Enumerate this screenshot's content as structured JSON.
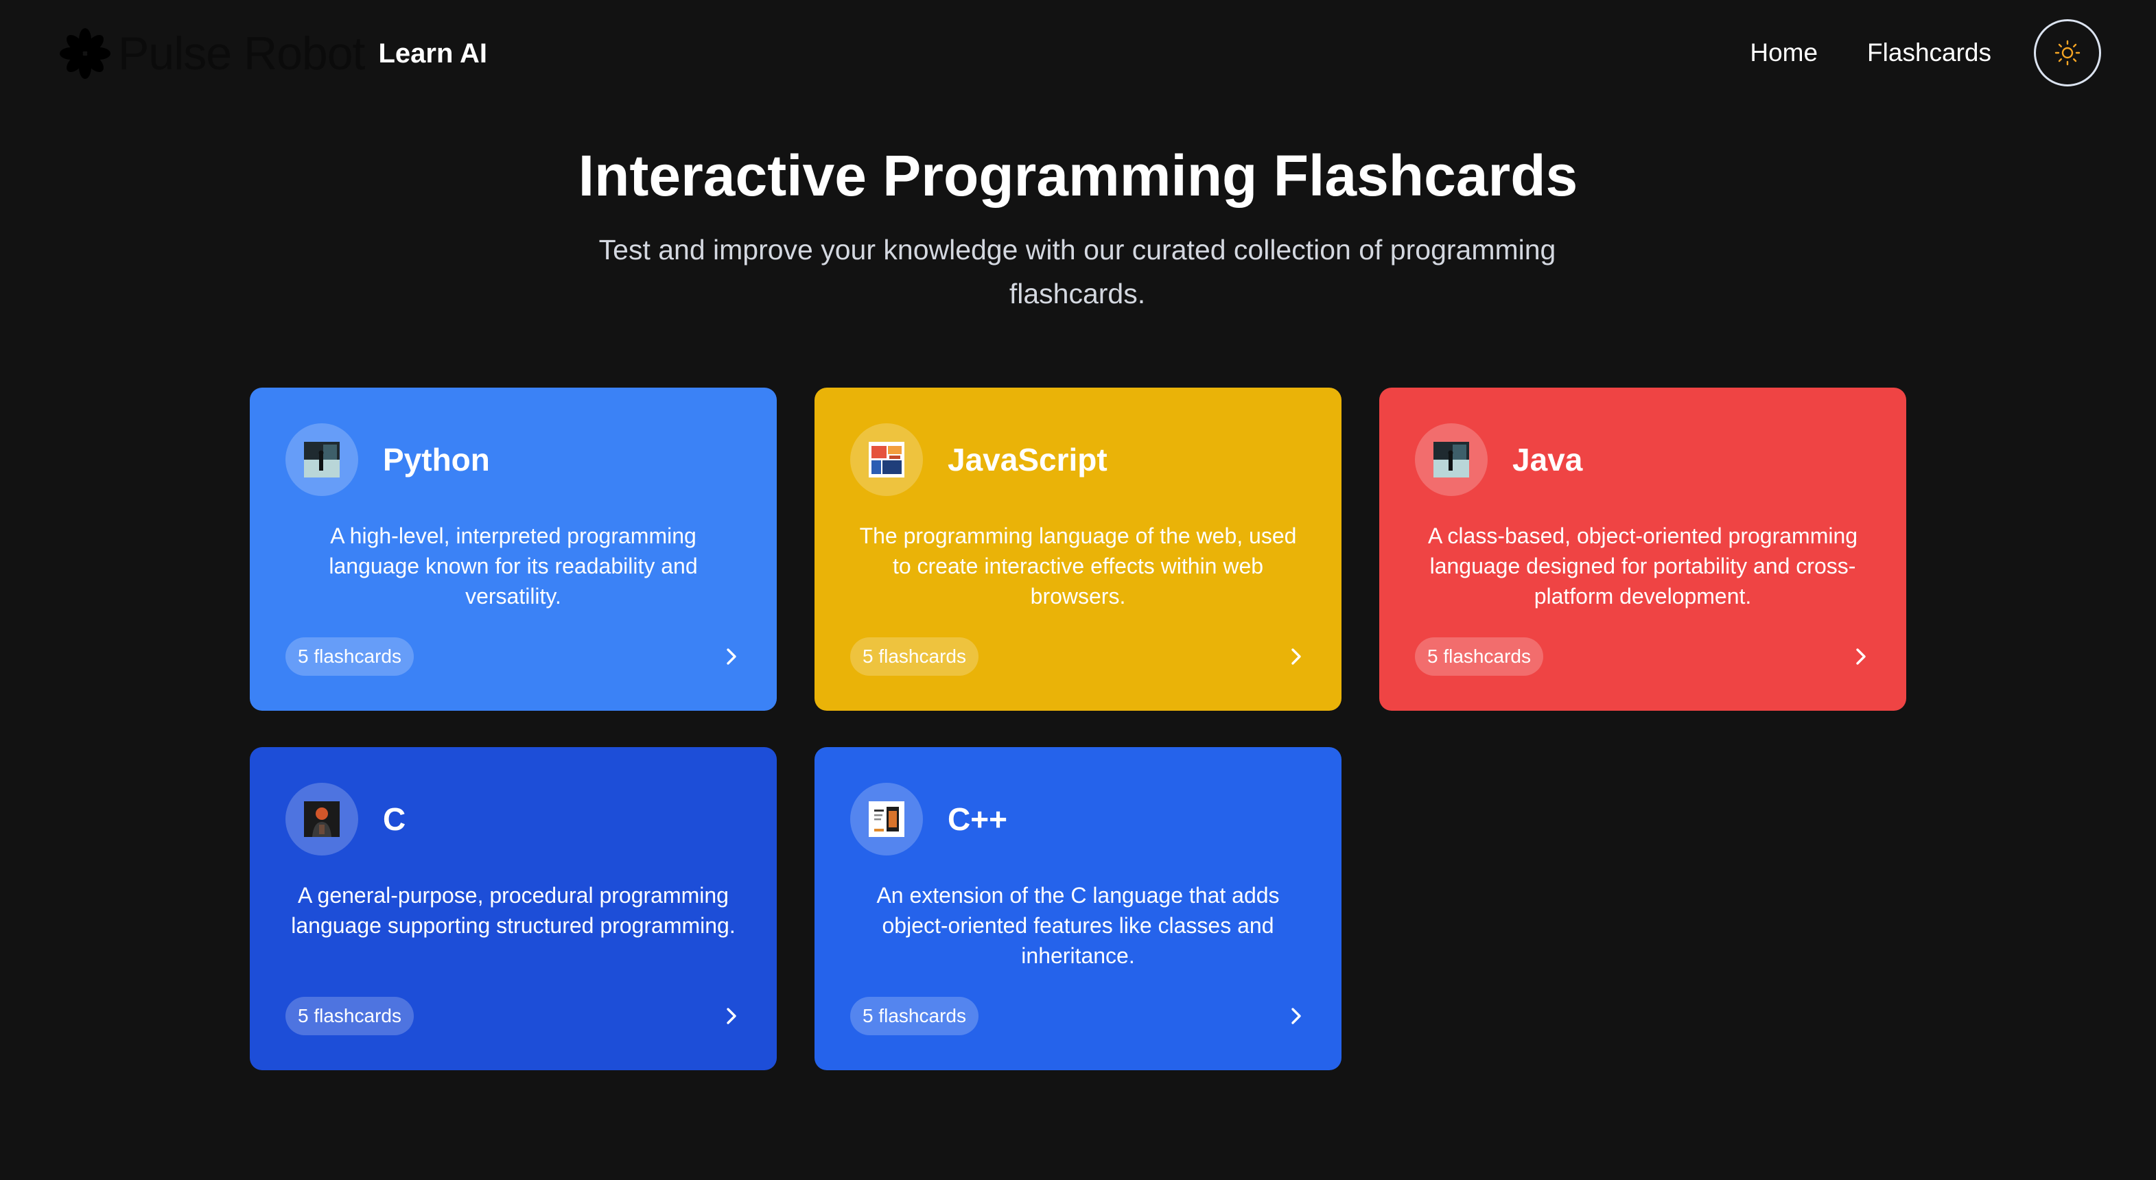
{
  "header": {
    "logo_text": "Pulse Robot",
    "logo_icon": "asterisk-logo-icon",
    "subtitle": "Learn AI",
    "nav": [
      {
        "label": "Home"
      },
      {
        "label": "Flashcards"
      }
    ],
    "theme_toggle_icon": "sun-icon",
    "theme_toggle_color": "#f5a524"
  },
  "hero": {
    "title": "Interactive Programming Flashcards",
    "subtitle": "Test and improve your knowledge with our curated collection of programming flashcards."
  },
  "cards": [
    {
      "title": "Python",
      "description": "A high-level, interpreted programming language known for its readability and versatility.",
      "count_label": "5 flashcards",
      "color": "#3b82f6",
      "thumbnail_icon": "person-at-window-thumbnail",
      "arrow_icon": "chevron-right-icon"
    },
    {
      "title": "JavaScript",
      "description": "The programming language of the web, used to create interactive effects within web browsers.",
      "count_label": "5 flashcards",
      "color": "#eab308",
      "thumbnail_icon": "collage-thumbnail",
      "arrow_icon": "chevron-right-icon"
    },
    {
      "title": "Java",
      "description": "A class-based, object-oriented programming language designed for portability and cross-platform development.",
      "count_label": "5 flashcards",
      "color": "#ef4444",
      "thumbnail_icon": "person-at-window-thumbnail",
      "arrow_icon": "chevron-right-icon"
    },
    {
      "title": "C",
      "description": "A general-purpose, procedural programming language supporting structured programming.",
      "count_label": "5 flashcards",
      "color": "#1d4ed8",
      "thumbnail_icon": "portrait-thumbnail",
      "arrow_icon": "chevron-right-icon"
    },
    {
      "title": "C++",
      "description": "An extension of the C language that adds object-oriented features like classes and inheritance.",
      "count_label": "5 flashcards",
      "color": "#2563eb",
      "thumbnail_icon": "poster-thumbnail",
      "arrow_icon": "chevron-right-icon"
    }
  ]
}
